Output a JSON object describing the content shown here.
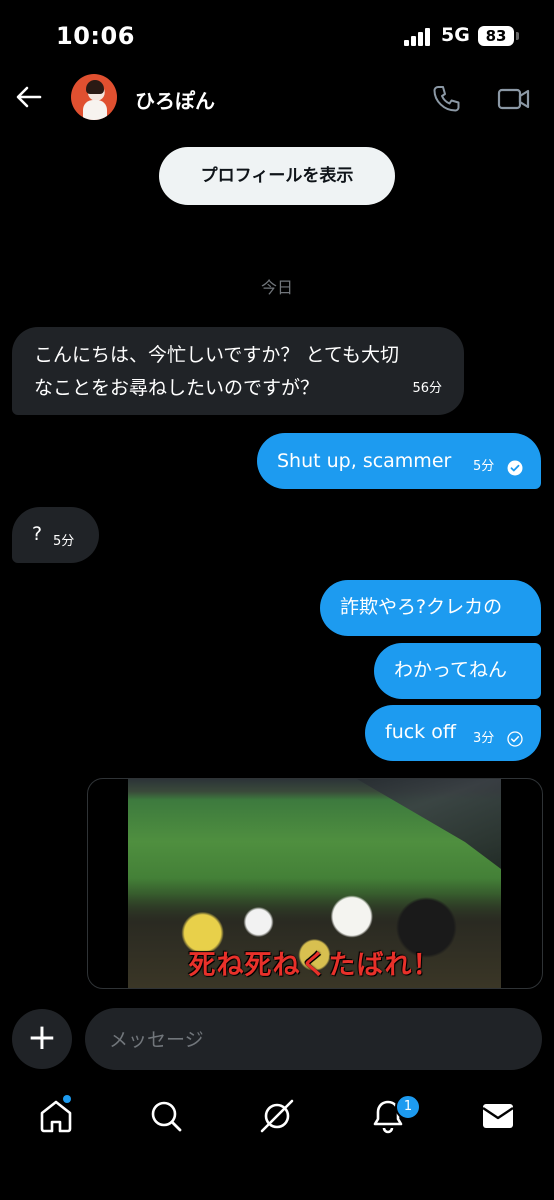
{
  "status_bar": {
    "time": "10:06",
    "network": "5G",
    "battery": "83"
  },
  "header": {
    "username": "ひろぽん"
  },
  "profile_button": "プロフィールを表示",
  "date_divider": "今日",
  "messages": [
    {
      "side": "in",
      "line1": "こんにちは、今忙しいですか？ とても大切",
      "line2": "なことをお尋ねしたいのですが？",
      "time": "56分"
    },
    {
      "side": "out",
      "text": "Shut up, scammer",
      "time": "5分",
      "read": true
    },
    {
      "side": "in",
      "text": "?",
      "time": "5分"
    },
    {
      "side": "out",
      "text": "詐欺やろ?クレカの"
    },
    {
      "side": "out",
      "text": "わかってねん"
    },
    {
      "side": "out",
      "text": "fuck off",
      "time": "3分",
      "read": false
    }
  ],
  "media": {
    "caption": "死ね死ねくたばれ！"
  },
  "composer": {
    "placeholder": "メッセージ"
  },
  "tab_bar": {
    "items": [
      "home-icon",
      "search-icon",
      "grok-icon",
      "notifications-icon",
      "messages-icon"
    ],
    "notifications_badge": "1"
  },
  "colors": {
    "accent": "#1d9bf0",
    "bubble_in": "#202327",
    "background": "#000000"
  }
}
